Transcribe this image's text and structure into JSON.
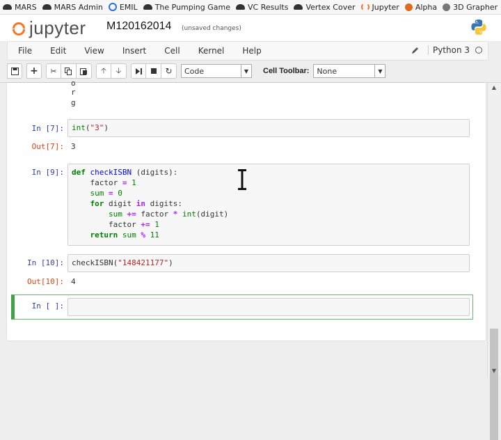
{
  "bookmarks": [
    {
      "icon": "car-icon",
      "label": "MARS"
    },
    {
      "icon": "car-icon",
      "label": "MARS Admin"
    },
    {
      "icon": "emil-icon",
      "label": "EMIL"
    },
    {
      "icon": "car-icon",
      "label": "The Pumping Game"
    },
    {
      "icon": "car-icon",
      "label": "VC Results"
    },
    {
      "icon": "car-icon",
      "label": "Vertex Cover"
    },
    {
      "icon": "jupyter-icon",
      "label": "Jupyter"
    },
    {
      "icon": "alpha-icon",
      "label": "Alpha"
    },
    {
      "icon": "grapher-icon",
      "label": "3D Grapher"
    }
  ],
  "header": {
    "logo_text": "jupyter",
    "notebook_name": "M120162014",
    "save_status": "(unsaved changes)"
  },
  "menu": {
    "items": [
      "File",
      "Edit",
      "View",
      "Insert",
      "Cell",
      "Kernel",
      "Help"
    ],
    "kernel_name": "Python 3"
  },
  "toolbar": {
    "cell_type": "Code",
    "cell_toolbar_label": "Cell Toolbar:",
    "cell_toolbar_value": "None"
  },
  "cells": {
    "partial_output": [
      "o",
      "r",
      "g"
    ],
    "c7": {
      "in": "In [7]:",
      "code": "int(\"3\")",
      "out_prompt": "Out[7]:",
      "out": "3"
    },
    "c9": {
      "in": "In [9]:",
      "lines": [
        "def checkISBN (digits):",
        "    factor = 1",
        "    sum = 0",
        "    for digit in digits:",
        "        sum += factor * int(digit)",
        "        factor += 1",
        "    return sum % 11"
      ]
    },
    "c10": {
      "in": "In [10]:",
      "code": "checkISBN(\"148421177\")",
      "out_prompt": "Out[10]:",
      "out": "4"
    },
    "empty": {
      "in": "In [ ]:"
    }
  },
  "colors": {
    "jupyter_orange": "#f37726",
    "in_prompt": "#303f9f",
    "out_prompt": "#d84315",
    "selected_cell": "#42a047"
  }
}
